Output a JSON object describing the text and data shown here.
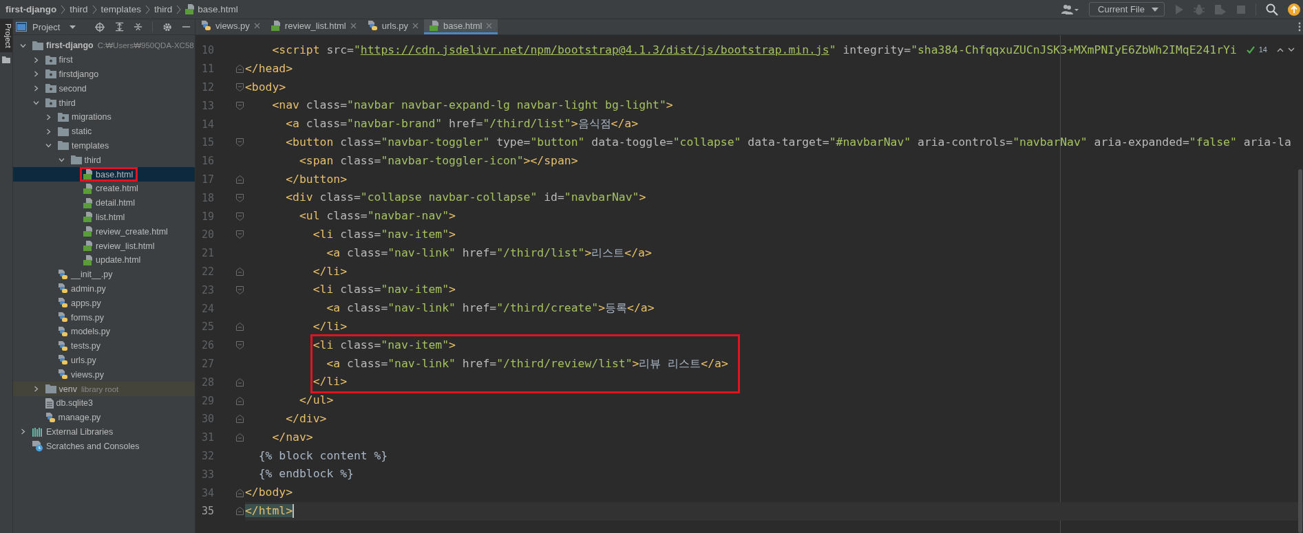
{
  "breadcrumb": [
    {
      "label": "first-django",
      "kind": "project"
    },
    {
      "label": "third",
      "kind": "folder"
    },
    {
      "label": "templates",
      "kind": "folder"
    },
    {
      "label": "third",
      "kind": "folder"
    },
    {
      "label": "base.html",
      "kind": "html"
    }
  ],
  "run_config": {
    "label": "Current File"
  },
  "tool_strip": [
    {
      "label": "Project",
      "selected": true
    }
  ],
  "project_panel": {
    "title": "Project",
    "tree": [
      {
        "label": "first-django",
        "kind": "folder",
        "hint": "C:₩Users₩950QDA-XC58",
        "expanded": true,
        "selected": false,
        "boxed": false,
        "children": [
          {
            "label": "first",
            "kind": "package",
            "expanded": false,
            "selected": false,
            "boxed": false
          },
          {
            "label": "firstdjango",
            "kind": "package",
            "expanded": false,
            "selected": false,
            "boxed": false
          },
          {
            "label": "second",
            "kind": "package",
            "expanded": false,
            "selected": false,
            "boxed": false
          },
          {
            "label": "third",
            "kind": "package",
            "expanded": true,
            "selected": false,
            "boxed": false,
            "children": [
              {
                "label": "migrations",
                "kind": "package",
                "expanded": false,
                "selected": false,
                "boxed": false
              },
              {
                "label": "static",
                "kind": "folder",
                "expanded": false,
                "selected": false,
                "boxed": false
              },
              {
                "label": "templates",
                "kind": "folder",
                "expanded": true,
                "selected": false,
                "boxed": false,
                "children": [
                  {
                    "label": "third",
                    "kind": "folder",
                    "expanded": true,
                    "selected": false,
                    "boxed": false,
                    "children": [
                      {
                        "label": "base.html",
                        "kind": "html",
                        "selected": true,
                        "boxed": true
                      },
                      {
                        "label": "create.html",
                        "kind": "html",
                        "selected": false,
                        "boxed": false
                      },
                      {
                        "label": "detail.html",
                        "kind": "html",
                        "selected": false,
                        "boxed": false
                      },
                      {
                        "label": "list.html",
                        "kind": "html",
                        "selected": false,
                        "boxed": false
                      },
                      {
                        "label": "review_create.html",
                        "kind": "html",
                        "selected": false,
                        "boxed": false
                      },
                      {
                        "label": "review_list.html",
                        "kind": "html",
                        "selected": false,
                        "boxed": false
                      },
                      {
                        "label": "update.html",
                        "kind": "html",
                        "selected": false,
                        "boxed": false
                      }
                    ]
                  }
                ]
              },
              {
                "label": "__init__.py",
                "kind": "py",
                "selected": false,
                "boxed": false
              },
              {
                "label": "admin.py",
                "kind": "py",
                "selected": false,
                "boxed": false
              },
              {
                "label": "apps.py",
                "kind": "py",
                "selected": false,
                "boxed": false
              },
              {
                "label": "forms.py",
                "kind": "py",
                "selected": false,
                "boxed": false
              },
              {
                "label": "models.py",
                "kind": "py",
                "selected": false,
                "boxed": false
              },
              {
                "label": "tests.py",
                "kind": "py",
                "selected": false,
                "boxed": false
              },
              {
                "label": "urls.py",
                "kind": "py",
                "selected": false,
                "boxed": false
              },
              {
                "label": "views.py",
                "kind": "py",
                "selected": false,
                "boxed": false
              }
            ]
          },
          {
            "label": "venv",
            "kind": "library",
            "hint": "library root",
            "expanded": false,
            "selected": false,
            "boxed": false
          },
          {
            "label": "db.sqlite3",
            "kind": "file",
            "selected": false,
            "boxed": false
          },
          {
            "label": "manage.py",
            "kind": "py",
            "selected": false,
            "boxed": false
          }
        ]
      },
      {
        "label": "External Libraries",
        "kind": "libraries",
        "expanded": false,
        "selected": false,
        "boxed": false
      },
      {
        "label": "Scratches and Consoles",
        "kind": "scratches",
        "selected": false,
        "boxed": false
      }
    ]
  },
  "tabs": [
    {
      "label": "views.py",
      "kind": "py",
      "selected": false
    },
    {
      "label": "review_list.html",
      "kind": "html",
      "selected": false
    },
    {
      "label": "urls.py",
      "kind": "py",
      "selected": false
    },
    {
      "label": "base.html",
      "kind": "html",
      "selected": true
    }
  ],
  "editor": {
    "inspection": {
      "count": "14"
    },
    "lines": [
      {
        "num": "10",
        "text": "    <script src=\"https://cdn.jsdelivr.net/npm/bootstrap@4.1.3/dist/js/bootstrap.min.js\" integrity=\"sha384-ChfqqxuZUCnJSK3+MXmPNIyE6ZbWh2IMqE241rYi",
        "kind": "plain",
        "current": false,
        "boxed": false
      },
      {
        "num": "11",
        "text": "</head>",
        "kind": "fold-end",
        "current": false,
        "boxed": false
      },
      {
        "num": "12",
        "text": "<body>",
        "kind": "fold-start",
        "current": false,
        "boxed": false
      },
      {
        "num": "13",
        "text": "    <nav class=\"navbar navbar-expand-lg navbar-light bg-light\">",
        "kind": "fold-start",
        "current": false,
        "boxed": false
      },
      {
        "num": "14",
        "text": "      <a class=\"navbar-brand\" href=\"/third/list\">음식점</a>",
        "kind": "plain",
        "current": false,
        "boxed": false
      },
      {
        "num": "15",
        "text": "      <button class=\"navbar-toggler\" type=\"button\" data-toggle=\"collapse\" data-target=\"#navbarNav\" aria-controls=\"navbarNav\" aria-expanded=\"false\" aria-la",
        "kind": "fold-start",
        "current": false,
        "boxed": false
      },
      {
        "num": "16",
        "text": "        <span class=\"navbar-toggler-icon\"></span>",
        "kind": "plain",
        "current": false,
        "boxed": false
      },
      {
        "num": "17",
        "text": "      </button>",
        "kind": "fold-end",
        "current": false,
        "boxed": false
      },
      {
        "num": "18",
        "text": "      <div class=\"collapse navbar-collapse\" id=\"navbarNav\">",
        "kind": "fold-start",
        "current": false,
        "boxed": false
      },
      {
        "num": "19",
        "text": "        <ul class=\"navbar-nav\">",
        "kind": "fold-start",
        "current": false,
        "boxed": false
      },
      {
        "num": "20",
        "text": "          <li class=\"nav-item\">",
        "kind": "fold-start",
        "current": false,
        "boxed": false
      },
      {
        "num": "21",
        "text": "            <a class=\"nav-link\" href=\"/third/list\">리스트</a>",
        "kind": "plain",
        "current": false,
        "boxed": false
      },
      {
        "num": "22",
        "text": "          </li>",
        "kind": "fold-end",
        "current": false,
        "boxed": false
      },
      {
        "num": "23",
        "text": "          <li class=\"nav-item\">",
        "kind": "fold-start",
        "current": false,
        "boxed": false
      },
      {
        "num": "24",
        "text": "            <a class=\"nav-link\" href=\"/third/create\">등록</a>",
        "kind": "plain",
        "current": false,
        "boxed": false
      },
      {
        "num": "25",
        "text": "          </li>",
        "kind": "fold-end",
        "current": false,
        "boxed": false
      },
      {
        "num": "26",
        "text": "          <li class=\"nav-item\">",
        "kind": "fold-start",
        "current": false,
        "boxed": true
      },
      {
        "num": "27",
        "text": "            <a class=\"nav-link\" href=\"/third/review/list\">리뷰 리스트</a>",
        "kind": "plain",
        "current": false,
        "boxed": true
      },
      {
        "num": "28",
        "text": "          </li>",
        "kind": "fold-end",
        "current": false,
        "boxed": true
      },
      {
        "num": "29",
        "text": "        </ul>",
        "kind": "fold-end",
        "current": false,
        "boxed": false
      },
      {
        "num": "30",
        "text": "      </div>",
        "kind": "fold-end",
        "current": false,
        "boxed": false
      },
      {
        "num": "31",
        "text": "    </nav>",
        "kind": "fold-end",
        "current": false,
        "boxed": false
      },
      {
        "num": "32",
        "text": "  {% block content %}",
        "kind": "plain",
        "current": false,
        "boxed": false
      },
      {
        "num": "33",
        "text": "  {% endblock %}",
        "kind": "plain",
        "current": false,
        "boxed": false
      },
      {
        "num": "34",
        "text": "</body>",
        "kind": "fold-end",
        "current": false,
        "boxed": false
      },
      {
        "num": "35",
        "text": "</html>",
        "kind": "fold-end",
        "current": true,
        "boxed": false
      }
    ]
  }
}
